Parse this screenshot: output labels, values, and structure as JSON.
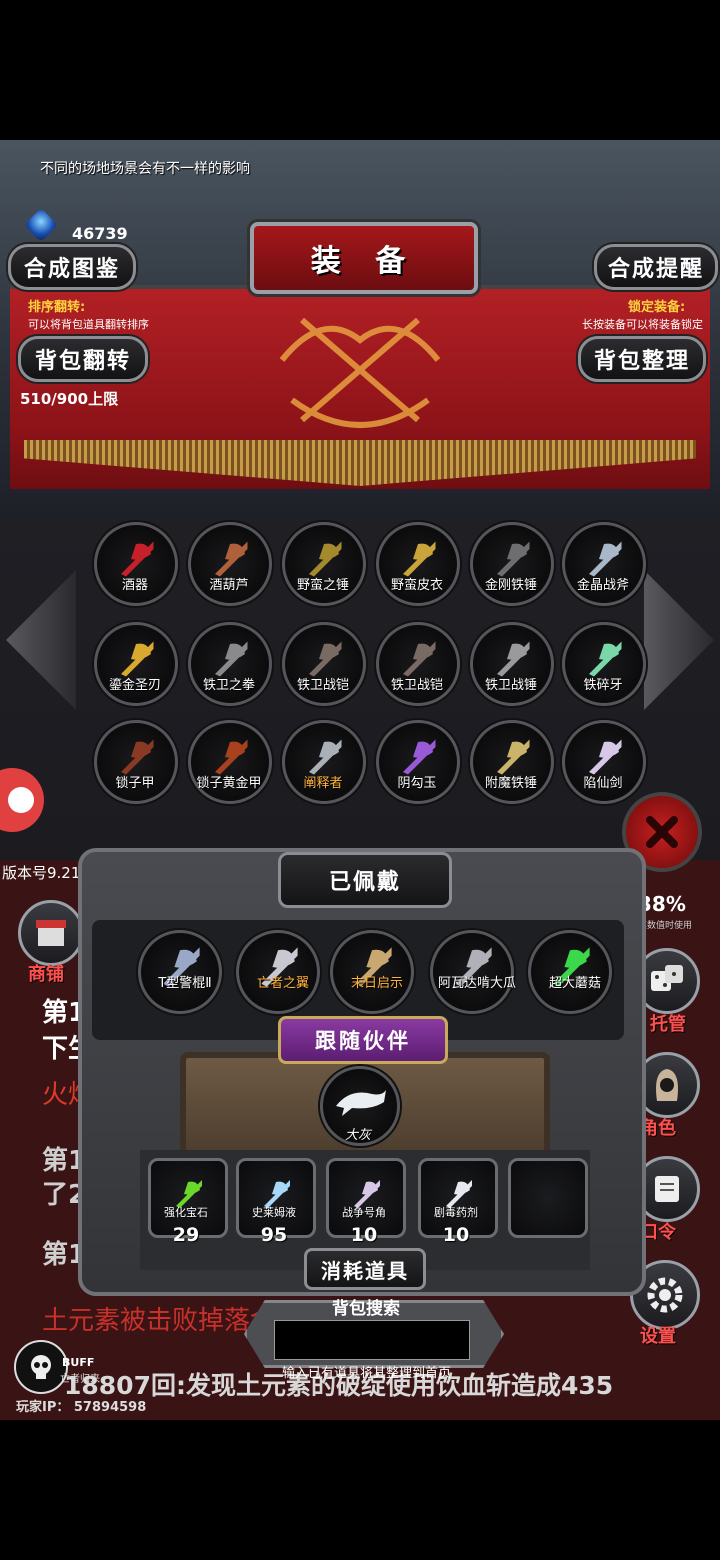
{
  "hud": {
    "tip": "不同的场地场景会有不一样的影响",
    "gem_count": "46739",
    "version": "版本号9.21",
    "player_ip": "玩家IP：  57894598",
    "buff_label": "BUFF",
    "buff_sub": "亡者归来"
  },
  "header": {
    "title": "装 备",
    "craft_book": "合成图鉴",
    "craft_hint": "合成提醒",
    "sort_flip_title": "排序翻转:",
    "sort_flip_desc": "可以将背包道具翻转排序",
    "sort_flip_button": "背包翻转",
    "lock_title": "锁定装备:",
    "lock_desc": "长按装备可以将装备锁定",
    "sort_button": "背包整理",
    "capacity": "510/900上限"
  },
  "inventory": [
    {
      "name": "酒器",
      "icon": "lips-icon",
      "color": "#c8202a",
      "highlight": false
    },
    {
      "name": "酒葫芦",
      "icon": "gourd-icon",
      "color": "#b0603a",
      "highlight": false
    },
    {
      "name": "野蛮之锤",
      "icon": "club-icon",
      "color": "#a48a2c",
      "highlight": false
    },
    {
      "name": "野蛮皮衣",
      "icon": "leather-armor-icon",
      "color": "#c9a43a",
      "highlight": false
    },
    {
      "name": "金刚铁锤",
      "icon": "hammer-icon",
      "color": "#6e6e70",
      "highlight": false
    },
    {
      "name": "金晶战斧",
      "icon": "axe-icon",
      "color": "#a8b8c8",
      "highlight": false
    },
    {
      "name": "鎏金圣刃",
      "icon": "golden-sword-icon",
      "color": "#d8a830",
      "highlight": false
    },
    {
      "name": "铁卫之拳",
      "icon": "gauntlet-icon",
      "color": "#8a8a8e",
      "highlight": false
    },
    {
      "name": "铁卫战铠",
      "icon": "iron-armor-icon",
      "color": "#7a6a64",
      "highlight": false
    },
    {
      "name": "铁卫战铠",
      "icon": "iron-armor-icon",
      "color": "#7a6a64",
      "highlight": false
    },
    {
      "name": "铁卫战锤",
      "icon": "mace-icon",
      "color": "#9a9a9c",
      "highlight": false
    },
    {
      "name": "铁碎牙",
      "icon": "jade-blade-icon",
      "color": "#7ad8a8",
      "highlight": false
    },
    {
      "name": "锁子甲",
      "icon": "chainmail-icon",
      "color": "#8a3a22",
      "highlight": false
    },
    {
      "name": "锁子黄金甲",
      "icon": "gold-chainmail-icon",
      "color": "#a8421e",
      "highlight": false
    },
    {
      "name": "阐释者",
      "icon": "dark-sword-icon",
      "color": "#aab0b8",
      "highlight": true
    },
    {
      "name": "阴勾玉",
      "icon": "purple-gem-icon",
      "color": "#9a5ad8",
      "highlight": false
    },
    {
      "name": "附魔铁锤",
      "icon": "enchanted-hammer-icon",
      "color": "#c9b46a",
      "highlight": false
    },
    {
      "name": "陷仙剑",
      "icon": "immortal-sword-icon",
      "color": "#d8c8e8",
      "highlight": false
    }
  ],
  "equipped": {
    "title": "已佩戴",
    "items": [
      {
        "name": "T型警棍Ⅱ",
        "icon": "baton-icon",
        "color": "#9aa8c8",
        "highlight": false
      },
      {
        "name": "亡者之翼",
        "icon": "wings-icon",
        "color": "#c8c8d0",
        "highlight": true
      },
      {
        "name": "末日启示",
        "icon": "scepter-icon",
        "color": "#c8a870",
        "highlight": true
      },
      {
        "name": "阿瓦达啃大瓜",
        "icon": "wand-icon",
        "color": "#b0b0b8",
        "highlight": false
      },
      {
        "name": "超大蘑菇",
        "icon": "mushroom-icon",
        "color": "#3ad84a",
        "highlight": false
      }
    ]
  },
  "partner": {
    "title": "跟随伙伴",
    "name": "大灰",
    "icon": "dolphin-icon"
  },
  "consumables": {
    "title": "消耗道具",
    "items": [
      {
        "name": "强化宝石",
        "count": "29",
        "icon": "green-gem-icon",
        "color": "#6ad82a"
      },
      {
        "name": "史莱姆液",
        "count": "95",
        "icon": "potion-icon",
        "color": "#a8d8f8"
      },
      {
        "name": "战争号角",
        "count": "10",
        "icon": "horn-icon",
        "color": "#d8c8e8"
      },
      {
        "name": "剧毒药剂",
        "count": "10",
        "icon": "poison-bottle-icon",
        "color": "#e8e8f0"
      }
    ]
  },
  "search": {
    "title": "背包搜索",
    "value": "",
    "hint": "输入已有道具将其整理到首页"
  },
  "log": {
    "l1": "第1",
    "l2": "下生",
    "l3": "火焰",
    "l4": "第1",
    "l5": "了2",
    "l6": "第1",
    "l7": "土元素被击败掉落金",
    "l8": "18807回:发现土元素的破绽使用饮血斩造成435"
  },
  "right_menu": {
    "shop": "商铺",
    "dice": "托管",
    "role": "角色",
    "code": "口令",
    "settings": "设置",
    "stat": "38%",
    "stat_sub": "其数值时使用"
  },
  "colors": {
    "accent_red": "#b22025",
    "gold": "#ffd23c",
    "orange_label": "#ffb13a"
  }
}
